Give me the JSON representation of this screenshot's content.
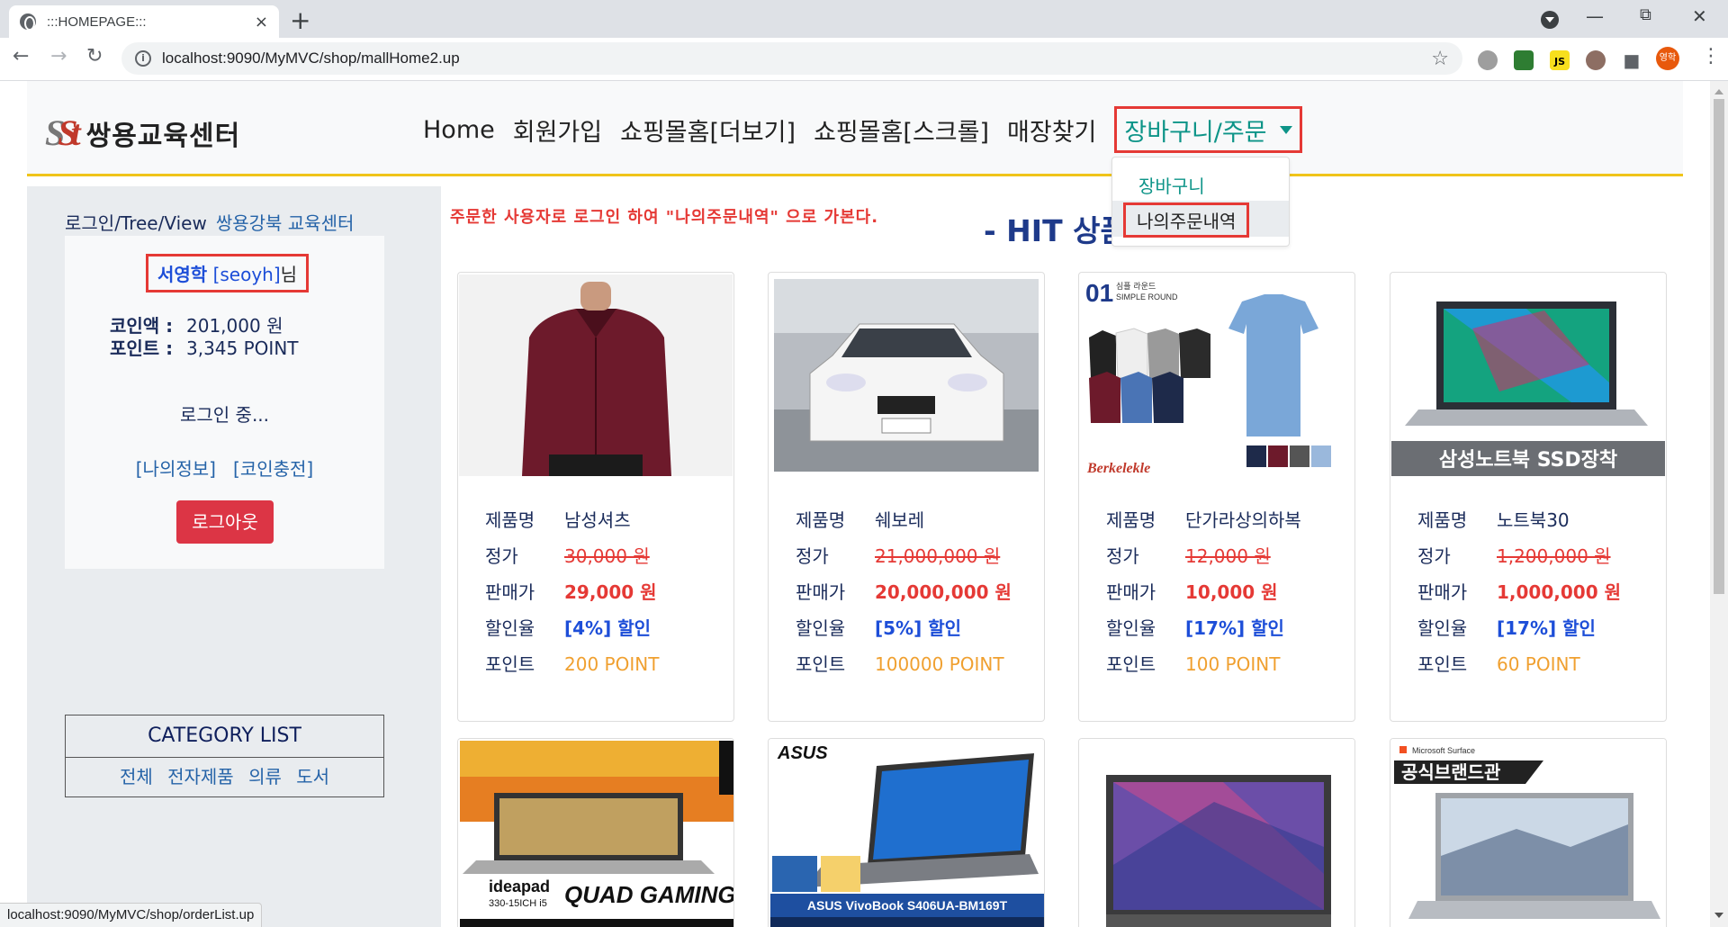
{
  "browser": {
    "tab_title": ":::HOMEPAGE:::",
    "tab_close": "×",
    "new_tab": "+",
    "url": "localhost:9090/MyMVC/shop/mallHome2.up",
    "profile_initials": "영학",
    "status_url": "localhost:9090/MyMVC/shop/orderList.up"
  },
  "header": {
    "logo_mark_s": "S",
    "logo_mark_t": "St",
    "logo_text": "쌍용교육센터",
    "nav": [
      "Home",
      "회원가입",
      "쇼핑몰홈[더보기]",
      "쇼핑몰홈[스크롤]",
      "매장찾기"
    ],
    "dropdown_label": "장바구니/주문",
    "dropdown_items": [
      "장바구니",
      "나의주문내역"
    ]
  },
  "sidebar": {
    "top_text": "로그인/Tree/View",
    "top_link": "쌍용강북 교육센터",
    "user_name": "서영학",
    "user_id": "[seoyh]",
    "user_suffix": "님",
    "coin_label": "코인액 :",
    "coin_value": "201,000 원",
    "point_label": "포인트 :",
    "point_value": "3,345 POINT",
    "status": "로그인 중...",
    "my_links": "[나의정보]   [코인충전]",
    "logout": "로그아웃",
    "category_title": "CATEGORY LIST",
    "category_links": "전체 전자제품 의류 도서"
  },
  "main": {
    "notice": "주문한 사용자로 로그인 하여 \"나의주문내역\" 으로 가본다.",
    "hit_title": "- HIT 상품"
  },
  "labels": {
    "name": "제품명",
    "list_price": "정가",
    "sale_price": "판매가",
    "discount": "할인율",
    "point": "포인트"
  },
  "products": [
    {
      "name": "남성셔츠",
      "list_price": "30,000 원",
      "sale_price": "29,000 원",
      "discount": "[4%] 할인",
      "point": "200 POINT"
    },
    {
      "name": "쉐보레",
      "list_price": "21,000,000 원",
      "sale_price": "20,000,000 원",
      "discount": "[5%] 할인",
      "point": "100000 POINT"
    },
    {
      "name": "단가라상의하복",
      "list_price": "12,000 원",
      "sale_price": "10,000 원",
      "discount": "[17%] 할인",
      "point": "100 POINT"
    },
    {
      "name": "노트북30",
      "list_price": "1,200,000 원",
      "sale_price": "1,000,000 원",
      "discount": "[17%] 할인",
      "point": "60 POINT"
    }
  ],
  "image_text": {
    "tshirt_no": "01",
    "tshirt_title": "심플 라운드",
    "tshirt_sub": "SIMPLE ROUND",
    "tshirt_brand": "Berkelekle",
    "laptop_banner": "삼성노트북 SSD장착",
    "lenovo_brand": "ideapad",
    "lenovo_model": "330-15ICH i5",
    "lenovo_slogan": "QUAD GAMING",
    "asus_brand": "ASUS",
    "asus_model": "ASUS VivoBook S406UA-BM169T",
    "surface_brand": "Microsoft Surface",
    "surface_banner": "공식브랜드관"
  },
  "colors": {
    "accent_teal": "#0d9488",
    "highlight_red": "#e53935",
    "header_border": "#f0c419",
    "logout_red": "#dc3545",
    "point_orange": "#f0a030"
  }
}
